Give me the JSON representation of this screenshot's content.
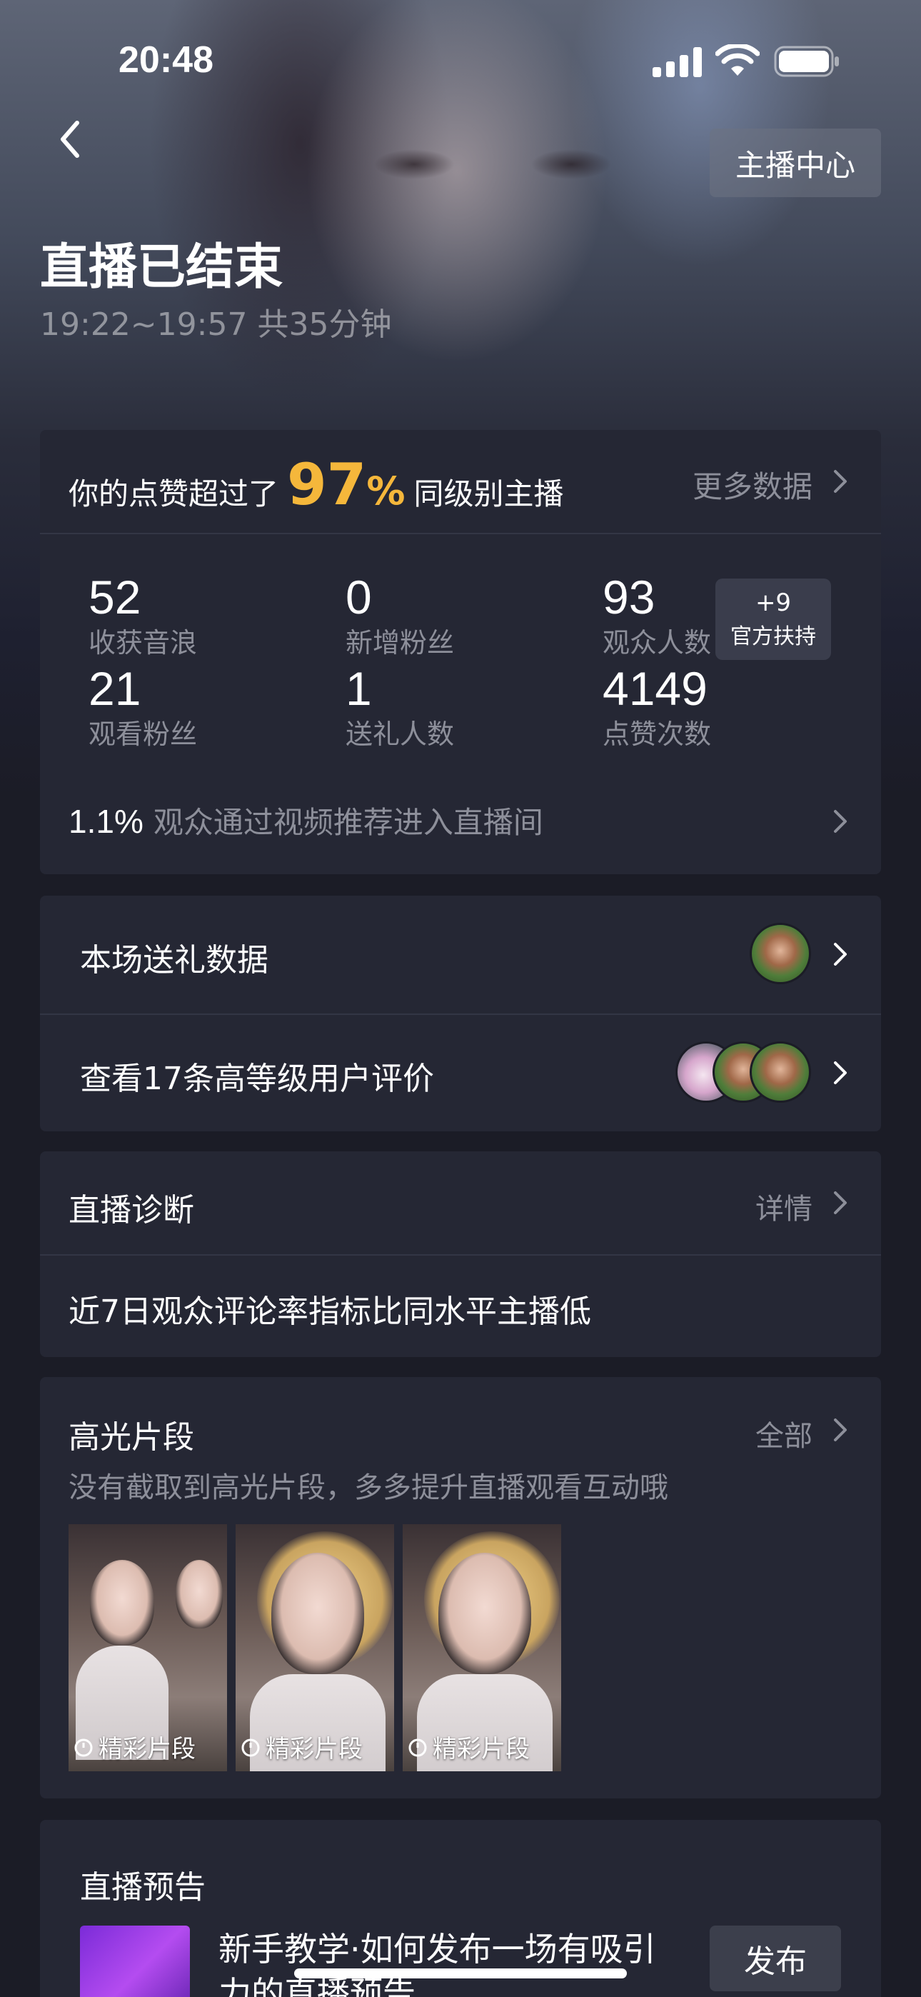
{
  "status_bar": {
    "time": "20:48"
  },
  "header": {
    "anchor_center_label": "主播中心",
    "title": "直播已结束",
    "subtitle": "19:22~19:57 共35分钟"
  },
  "stats": {
    "like_prefix": "你的点赞超过了",
    "like_percent": "97",
    "like_percent_sign": "%",
    "like_suffix": "同级别主播",
    "more_data_label": "更多数据",
    "items": [
      {
        "value": "52",
        "label": "收获音浪"
      },
      {
        "value": "0",
        "label": "新增粉丝"
      },
      {
        "value": "93",
        "label": "观众人数"
      },
      {
        "value": "21",
        "label": "观看粉丝"
      },
      {
        "value": "1",
        "label": "送礼人数"
      },
      {
        "value": "4149",
        "label": "点赞次数"
      }
    ],
    "boost": {
      "value": "+9",
      "label": "官方扶持"
    },
    "recommend_percent": "1.1%",
    "recommend_text": "观众通过视频推荐进入直播间"
  },
  "gift": {
    "gift_data_label": "本场送礼数据",
    "reviews_label": "查看17条高等级用户评价"
  },
  "diagnosis": {
    "title": "直播诊断",
    "detail_label": "详情",
    "text": "近7日观众评论率指标比同水平主播低"
  },
  "highlights": {
    "title": "高光片段",
    "all_label": "全部",
    "subtitle": "没有截取到高光片段，多多提升直播观看互动哦",
    "clips": [
      {
        "label": "精彩片段"
      },
      {
        "label": "精彩片段"
      },
      {
        "label": "精彩片段"
      }
    ]
  },
  "preview": {
    "title": "直播预告",
    "text": "新手教学·如何发布一场有吸引力的直播预告",
    "publish_label": "发布"
  },
  "colors": {
    "accent": "#f5b73b",
    "background": "#1b1c26",
    "card": "#252734",
    "muted_text": "#8d8f9a"
  },
  "icons": [
    "back-icon",
    "chevron-right-icon",
    "signal-icon",
    "wifi-icon",
    "battery-icon",
    "clip-icon"
  ]
}
